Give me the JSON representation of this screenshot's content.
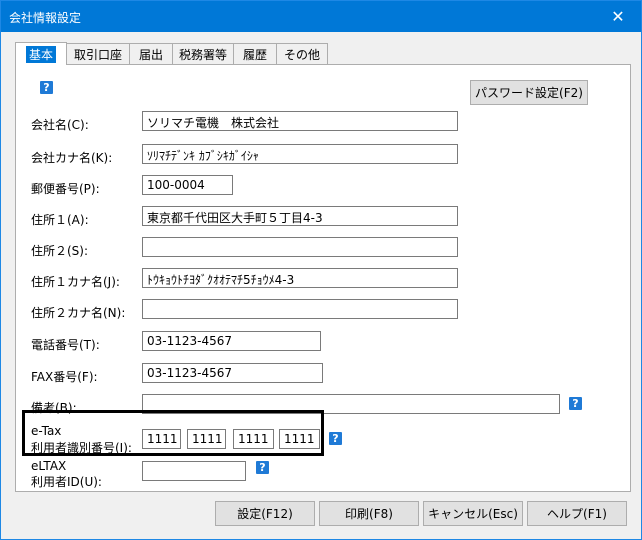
{
  "window": {
    "title": "会社情報設定",
    "close_label": "✕"
  },
  "tabs": [
    "基本",
    "取引口座",
    "届出",
    "税務署等",
    "履歴",
    "その他"
  ],
  "help_label": "?",
  "password_button": "パスワード設定(F2)",
  "fields": {
    "company_name": {
      "label": "会社名(C):",
      "value": "ソリマチ電機　株式会社"
    },
    "company_kana": {
      "label": "会社カナ名(K):",
      "value": "ｿﾘﾏﾁﾃﾞﾝｷ ｶﾌﾞｼｷｶﾞｲｼｬ"
    },
    "postal": {
      "label": "郵便番号(P):",
      "value": "100-0004"
    },
    "address1": {
      "label": "住所１(A):",
      "value": "東京都千代田区大手町５丁目4-3"
    },
    "address2": {
      "label": "住所２(S):",
      "value": ""
    },
    "address1_kana": {
      "label": "住所１カナ名(J):",
      "value": "ﾄｳｷｮｳﾄﾁﾖﾀﾞｸｵｵﾃﾏﾁ5ﾁｮｳﾒ4-3"
    },
    "address2_kana": {
      "label": "住所２カナ名(N):",
      "value": ""
    },
    "phone": {
      "label": "電話番号(T):",
      "value": "03-1123-4567"
    },
    "fax": {
      "label": "FAX番号(F):",
      "value": "03-1123-4567"
    },
    "notes": {
      "label": "備考(B):",
      "value": ""
    },
    "etax": {
      "label1": "e-Tax",
      "label2": "利用者識別番号(I):",
      "values": [
        "1111",
        "1111",
        "1111",
        "1111"
      ]
    },
    "eltax": {
      "label1": "eLTAX",
      "label2": "利用者ID(U):",
      "value": ""
    }
  },
  "buttons": {
    "settings": "設定(F12)",
    "print": "印刷(F8)",
    "cancel": "キャンセル(Esc)",
    "help": "ヘルプ(F1)"
  }
}
